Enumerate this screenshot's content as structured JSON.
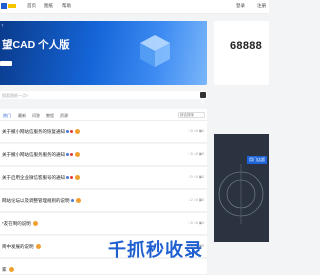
{
  "topnav": {
    "links": [
      "首页",
      "图纸",
      "帮助"
    ],
    "login": "登录",
    "register": "注册"
  },
  "banner": {
    "tag": "T",
    "title": "望CAD 个人版"
  },
  "sidebar": {
    "phone": "68888",
    "promo_text": "用门店超"
  },
  "search": {
    "placeholder": "搜索图纸一点?"
  },
  "tabs": {
    "items": [
      "热门",
      "最新",
      "问答",
      "教程",
      "资源"
    ],
    "sort_label": "综合排序"
  },
  "posts": [
    {
      "title": "关于撤小网站信服务的恢复通知",
      "likes": "0",
      "comments": "0",
      "views": "0"
    },
    {
      "title": "关于撤小网站信服务服务的通知",
      "likes": "0",
      "comments": "0",
      "views": "0"
    },
    {
      "title": "关于启用企业微信客服号的通知",
      "likes": "0",
      "comments": "0",
      "views": "0"
    },
    {
      "title": "网站论坛以及调整管理规则的说明",
      "likes": "2",
      "comments": "0",
      "views": "0"
    },
    {
      "title": "*友在制的说明",
      "likes": "0",
      "comments": "0",
      "views": "0"
    },
    {
      "title": "简中发展的说明",
      "likes": "0",
      "comments": "0",
      "views": "0"
    },
    {
      "title": "家",
      "likes": "0",
      "comments": "0",
      "views": "0"
    }
  ],
  "overlay": {
    "brand": "千抓秒收录"
  },
  "colors": {
    "accent": "#1f5fd0",
    "banner": "#1565d8"
  }
}
